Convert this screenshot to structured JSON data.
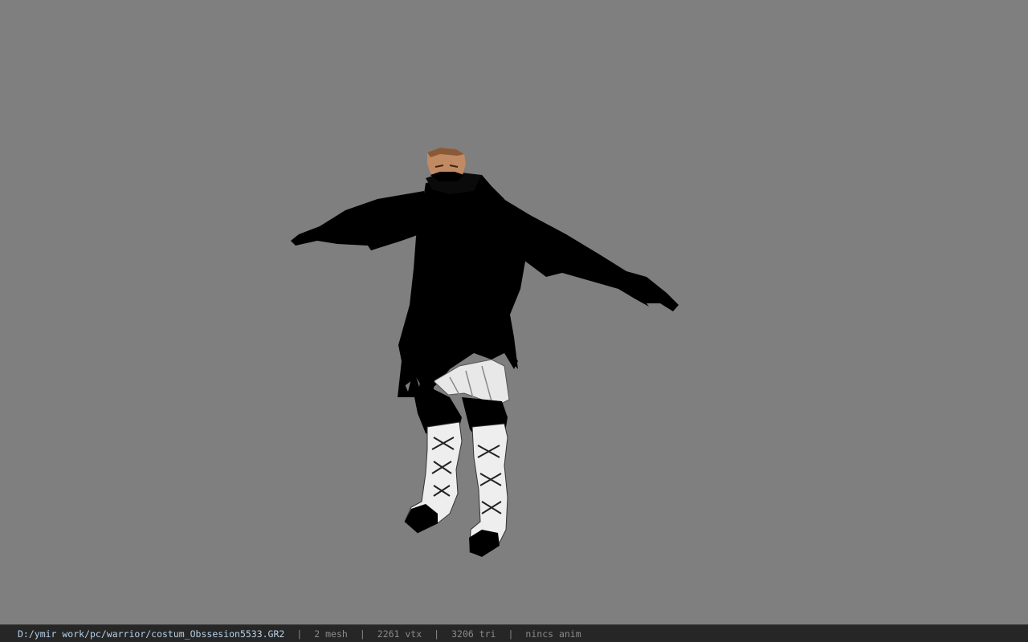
{
  "viewport": {
    "background_color": "#7f7f7f",
    "model_icon": "character-model-icon"
  },
  "statusbar": {
    "file_path": "D:/ymir work/pc/warrior/costum_Obssesion5533.GR2",
    "separator": "|",
    "mesh_count": "2 mesh",
    "vertex_count": "2261 vtx",
    "triangle_count": "3206 tri",
    "animation": "nincs anim"
  }
}
